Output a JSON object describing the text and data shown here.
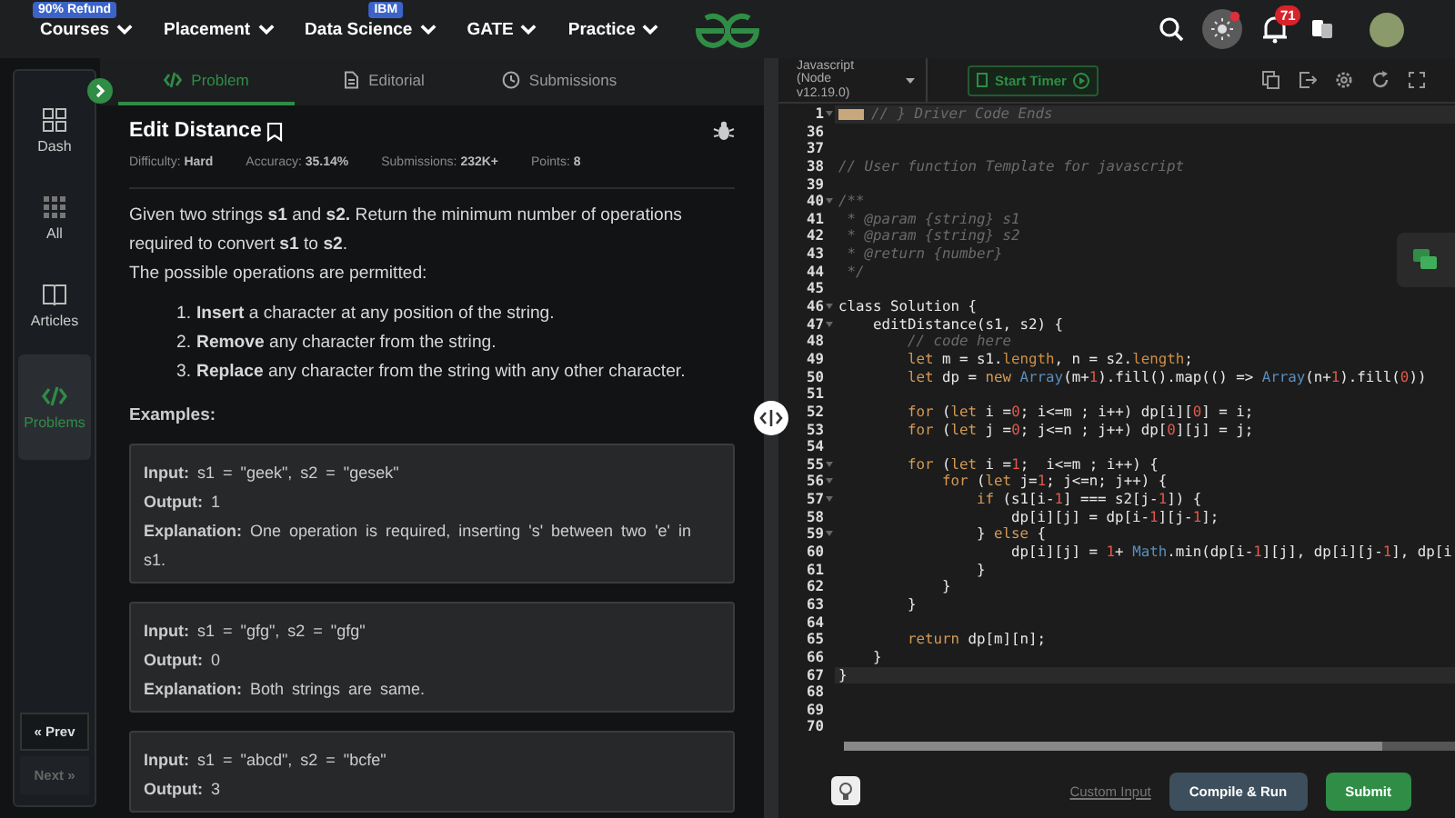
{
  "top_nav": {
    "items": [
      {
        "label": "Courses",
        "badge": "90% Refund"
      },
      {
        "label": "Placement"
      },
      {
        "label": "Data Science",
        "badge": "IBM"
      },
      {
        "label": "GATE"
      },
      {
        "label": "Practice"
      }
    ],
    "notification_count": "71"
  },
  "sidebar": {
    "items": [
      {
        "label": "Dash",
        "kind": "dash",
        "selected": false
      },
      {
        "label": "All",
        "kind": "all",
        "selected": false
      },
      {
        "label": "Articles",
        "kind": "articles",
        "selected": false
      },
      {
        "label": "Problems",
        "kind": "problems",
        "selected": true
      }
    ],
    "prev": {
      "label": "« Prev",
      "disabled": false
    },
    "next": {
      "label": "Next »",
      "disabled": true
    }
  },
  "problem": {
    "tabs": [
      {
        "label": "Problem",
        "kind": "code",
        "selected": true
      },
      {
        "label": "Editorial",
        "kind": "doc",
        "selected": false
      },
      {
        "label": "Submissions",
        "kind": "clock",
        "selected": false
      }
    ],
    "title": "Edit Distance",
    "stats": [
      "Difficulty: **Hard**",
      "Accuracy: **35.14%**",
      "Submissions: **232K+**",
      "Points: **8**"
    ],
    "description": [
      "Given two strings **s1** and **s2.** Return the minimum number of operations required to convert **s1** to **s2**.",
      "The possible operations are permitted:"
    ],
    "operations": [
      {
        "number": "1.",
        "text": "**Insert** a character at any position of the string."
      },
      {
        "number": "2.",
        "text": "**Remove** any character from the string."
      },
      {
        "number": "3.",
        "text": "**Replace** any character from the string with any other character."
      }
    ],
    "examples_heading": "Examples:",
    "examples": [
      [
        "**Input:** s1 = \"geek\", s2 = \"gesek\"",
        "**Output:** 1",
        "**Explanation:** One operation is required, inserting 's' between two 'e' in s1."
      ],
      [
        "**Input:** s1 = \"gfg\", s2 = \"gfg\"",
        "**Output:** 0",
        "**Explanation:** Both strings are same."
      ],
      [
        "**Input:** s1 = \"abcd\", s2 = \"bcfe\"",
        "**Output:** 3"
      ]
    ]
  },
  "editor": {
    "language": "Javascript (Node v12.19.0)",
    "timer": "Start Timer",
    "lines": [
      {
        "number": "1",
        "fold": true,
        "highlighted": true,
        "segments": [
          {
            "kind": "comment",
            "text": "// } Driver Code Ends"
          }
        ]
      },
      {
        "number": "36",
        "fold": false,
        "highlighted": false
      },
      {
        "number": "37",
        "fold": false,
        "highlighted": false
      },
      {
        "number": "38",
        "fold": false,
        "highlighted": false,
        "segments": [
          {
            "kind": "comment",
            "text": "// User function Template for javascript"
          }
        ]
      },
      {
        "number": "39",
        "fold": false,
        "highlighted": false
      },
      {
        "number": "40",
        "fold": true,
        "highlighted": false,
        "segments": [
          {
            "kind": "comment",
            "text": "/**"
          }
        ]
      },
      {
        "number": "41",
        "fold": false,
        "highlighted": false,
        "segments": [
          {
            "kind": "comment",
            "text": " * @param {string} s1"
          }
        ]
      },
      {
        "number": "42",
        "fold": false,
        "highlighted": false,
        "segments": [
          {
            "kind": "comment",
            "text": " * @param {string} s2"
          }
        ]
      },
      {
        "number": "43",
        "fold": false,
        "highlighted": false,
        "segments": [
          {
            "kind": "comment",
            "text": " * @return {number}"
          }
        ]
      },
      {
        "number": "44",
        "fold": false,
        "highlighted": false,
        "segments": [
          {
            "kind": "comment",
            "text": " */"
          }
        ]
      },
      {
        "number": "45",
        "fold": false,
        "highlighted": false
      },
      {
        "number": "46",
        "fold": true,
        "highlighted": false,
        "segments": [
          {
            "kind": "plain",
            "text": "class Solution {"
          }
        ]
      },
      {
        "number": "47",
        "fold": true,
        "highlighted": false,
        "segments": [
          {
            "kind": "plain",
            "text": "    editDistance(s1, s2) {"
          }
        ]
      },
      {
        "number": "48",
        "fold": false,
        "highlighted": false,
        "segments": [
          {
            "kind": "comment",
            "text": "        // code here"
          }
        ]
      },
      {
        "number": "49",
        "fold": false,
        "highlighted": false,
        "segments": [
          {
            "kind": "keyword",
            "text": "        let"
          },
          {
            "kind": "plain",
            "text": " m = s1."
          },
          {
            "kind": "property",
            "text": "length"
          },
          {
            "kind": "plain",
            "text": ", n = s2."
          },
          {
            "kind": "property",
            "text": "length"
          },
          {
            "kind": "plain",
            "text": ";"
          }
        ]
      },
      {
        "number": "50",
        "fold": false,
        "highlighted": false,
        "segments": [
          {
            "kind": "keyword",
            "text": "        let"
          },
          {
            "kind": "plain",
            "text": " dp = "
          },
          {
            "kind": "keyword",
            "text": "new"
          },
          {
            "kind": "builtin",
            "text": " Array"
          },
          {
            "kind": "plain",
            "text": "(m+"
          },
          {
            "kind": "number",
            "text": "1"
          },
          {
            "kind": "plain",
            "text": ").fill().map(() => "
          },
          {
            "kind": "builtin",
            "text": "Array"
          },
          {
            "kind": "plain",
            "text": "(n+"
          },
          {
            "kind": "number",
            "text": "1"
          },
          {
            "kind": "plain",
            "text": ").fill("
          },
          {
            "kind": "number",
            "text": "0"
          },
          {
            "kind": "plain",
            "text": "))"
          }
        ]
      },
      {
        "number": "51",
        "fold": false,
        "highlighted": false
      },
      {
        "number": "52",
        "fold": false,
        "highlighted": false,
        "segments": [
          {
            "kind": "keyword",
            "text": "        for"
          },
          {
            "kind": "plain",
            "text": " ("
          },
          {
            "kind": "keyword",
            "text": "let"
          },
          {
            "kind": "plain",
            "text": " i ="
          },
          {
            "kind": "number",
            "text": "0"
          },
          {
            "kind": "plain",
            "text": "; i<=m ; i++) dp[i]["
          },
          {
            "kind": "number",
            "text": "0"
          },
          {
            "kind": "plain",
            "text": "] = i;"
          }
        ]
      },
      {
        "number": "53",
        "fold": false,
        "highlighted": false,
        "segments": [
          {
            "kind": "keyword",
            "text": "        for"
          },
          {
            "kind": "plain",
            "text": " ("
          },
          {
            "kind": "keyword",
            "text": "let"
          },
          {
            "kind": "plain",
            "text": " j ="
          },
          {
            "kind": "number",
            "text": "0"
          },
          {
            "kind": "plain",
            "text": "; j<=n ; j++) dp["
          },
          {
            "kind": "number",
            "text": "0"
          },
          {
            "kind": "plain",
            "text": "][j] = j;"
          }
        ]
      },
      {
        "number": "54",
        "fold": false,
        "highlighted": false
      },
      {
        "number": "55",
        "fold": true,
        "highlighted": false,
        "segments": [
          {
            "kind": "keyword",
            "text": "        for"
          },
          {
            "kind": "plain",
            "text": " ("
          },
          {
            "kind": "keyword",
            "text": "let"
          },
          {
            "kind": "plain",
            "text": " i ="
          },
          {
            "kind": "number",
            "text": "1"
          },
          {
            "kind": "plain",
            "text": ";  i<=m ; i++) {"
          }
        ]
      },
      {
        "number": "56",
        "fold": true,
        "highlighted": false,
        "segments": [
          {
            "kind": "keyword",
            "text": "            for"
          },
          {
            "kind": "plain",
            "text": " ("
          },
          {
            "kind": "keyword",
            "text": "let"
          },
          {
            "kind": "plain",
            "text": " j="
          },
          {
            "kind": "number",
            "text": "1"
          },
          {
            "kind": "plain",
            "text": "; j<=n; j++) {"
          }
        ]
      },
      {
        "number": "57",
        "fold": true,
        "highlighted": false,
        "segments": [
          {
            "kind": "keyword",
            "text": "                if"
          },
          {
            "kind": "plain",
            "text": " (s1[i-"
          },
          {
            "kind": "number",
            "text": "1"
          },
          {
            "kind": "plain",
            "text": "] === s2[j-"
          },
          {
            "kind": "number",
            "text": "1"
          },
          {
            "kind": "plain",
            "text": "]) {"
          }
        ]
      },
      {
        "number": "58",
        "fold": false,
        "highlighted": false,
        "segments": [
          {
            "kind": "plain",
            "text": "                    dp[i][j] = dp[i-"
          },
          {
            "kind": "number",
            "text": "1"
          },
          {
            "kind": "plain",
            "text": "][j-"
          },
          {
            "kind": "number",
            "text": "1"
          },
          {
            "kind": "plain",
            "text": "];"
          }
        ]
      },
      {
        "number": "59",
        "fold": true,
        "highlighted": false,
        "segments": [
          {
            "kind": "plain",
            "text": "                } "
          },
          {
            "kind": "keyword",
            "text": "else"
          },
          {
            "kind": "plain",
            "text": " {"
          }
        ]
      },
      {
        "number": "60",
        "fold": false,
        "highlighted": false,
        "segments": [
          {
            "kind": "plain",
            "text": "                    dp[i][j] = "
          },
          {
            "kind": "number",
            "text": "1"
          },
          {
            "kind": "plain",
            "text": "+ "
          },
          {
            "kind": "builtin",
            "text": "Math"
          },
          {
            "kind": "plain",
            "text": ".min(dp[i-"
          },
          {
            "kind": "number",
            "text": "1"
          },
          {
            "kind": "plain",
            "text": "][j], dp[i][j-"
          },
          {
            "kind": "number",
            "text": "1"
          },
          {
            "kind": "plain",
            "text": "], dp[i"
          }
        ]
      },
      {
        "number": "61",
        "fold": false,
        "highlighted": false,
        "segments": [
          {
            "kind": "plain",
            "text": "                }"
          }
        ]
      },
      {
        "number": "62",
        "fold": false,
        "highlighted": false,
        "segments": [
          {
            "kind": "plain",
            "text": "            }"
          }
        ]
      },
      {
        "number": "63",
        "fold": false,
        "highlighted": false,
        "segments": [
          {
            "kind": "plain",
            "text": "        }"
          }
        ]
      },
      {
        "number": "64",
        "fold": false,
        "highlighted": false
      },
      {
        "number": "65",
        "fold": false,
        "highlighted": false,
        "segments": [
          {
            "kind": "keyword",
            "text": "        return"
          },
          {
            "kind": "plain",
            "text": " dp[m][n];"
          }
        ]
      },
      {
        "number": "66",
        "fold": false,
        "highlighted": false,
        "segments": [
          {
            "kind": "plain",
            "text": "    }"
          }
        ]
      },
      {
        "number": "67",
        "fold": false,
        "highlighted": true,
        "segments": [
          {
            "kind": "plain",
            "text": "}"
          }
        ]
      },
      {
        "number": "68",
        "fold": false,
        "highlighted": false
      },
      {
        "number": "69",
        "fold": false,
        "highlighted": false
      },
      {
        "number": "70",
        "fold": false,
        "highlighted": false
      }
    ],
    "custom_input": "Custom Input",
    "compile": "Compile & Run",
    "submit": "Submit"
  }
}
